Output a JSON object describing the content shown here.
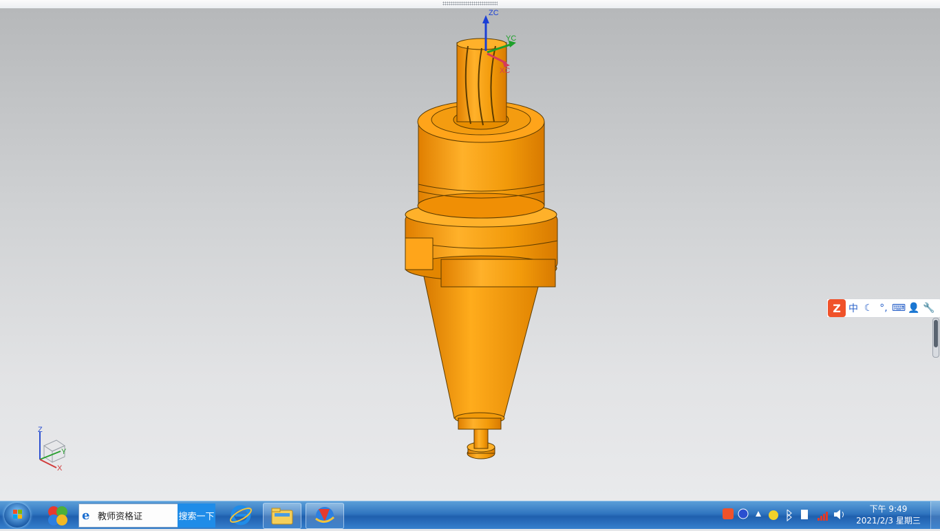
{
  "viewport": {
    "axes": {
      "zc": "ZC",
      "yc": "YC",
      "xc": "XC"
    },
    "triad": {
      "z": "Z",
      "y": "Y",
      "x": "X"
    },
    "model_color": "#f29a0a"
  },
  "ime_toolbar": {
    "logo": "Z",
    "mode": "中",
    "items": [
      "moon-icon",
      "punctuation-icon",
      "keyboard-icon",
      "user-icon",
      "wrench-icon"
    ]
  },
  "taskbar": {
    "search_text": "教师资格证",
    "search_button": "搜索一下",
    "clock_time": "下午 9:49",
    "clock_date": "2021/2/3 星期三",
    "colors": {
      "taskbar": "#2f74bf",
      "search_button": "#1f8ce8"
    }
  }
}
